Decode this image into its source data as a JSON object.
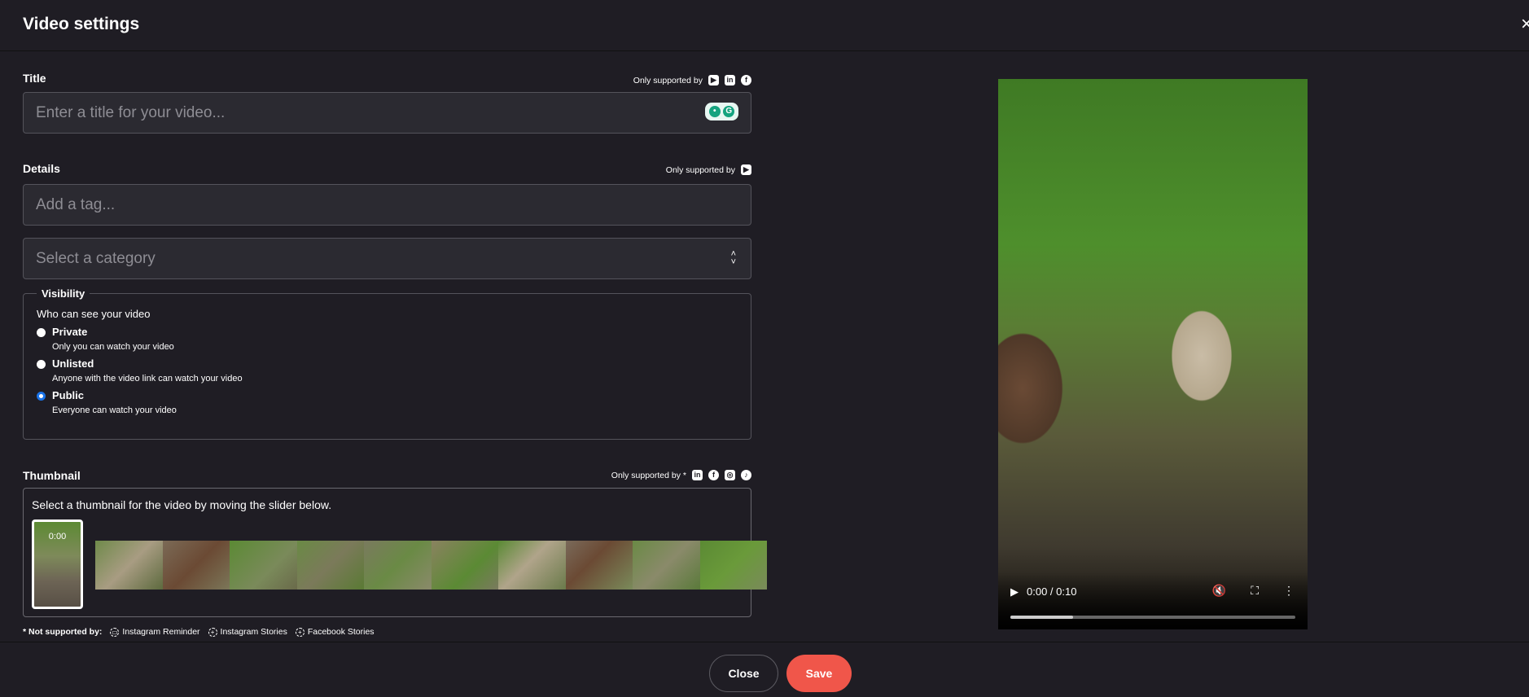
{
  "header": {
    "title": "Video settings",
    "close_icon": "×"
  },
  "title_section": {
    "label": "Title",
    "supported_label": "Only supported by",
    "platforms": [
      "youtube",
      "linkedin",
      "facebook"
    ],
    "placeholder": "Enter a title for your video..."
  },
  "details_section": {
    "label": "Details",
    "supported_label": "Only supported by",
    "platforms": [
      "youtube"
    ],
    "tag_placeholder": "Add a tag...",
    "category_placeholder": "Select a category"
  },
  "visibility": {
    "legend": "Visibility",
    "question": "Who can see your video",
    "options": [
      {
        "label": "Private",
        "desc": "Only you can watch your video",
        "selected": false
      },
      {
        "label": "Unlisted",
        "desc": "Anyone with the video link can watch your video",
        "selected": false
      },
      {
        "label": "Public",
        "desc": "Everyone can watch your video",
        "selected": true
      }
    ],
    "accent": "#1a73e8"
  },
  "thumbnail": {
    "label": "Thumbnail",
    "supported_label": "Only supported by *",
    "platforms": [
      "linkedin",
      "facebook",
      "instagram",
      "tiktok"
    ],
    "instruction": "Select a thumbnail for the video by moving the slider below.",
    "selected_time": "0:00"
  },
  "not_supported": {
    "label": "* Not supported by:",
    "items": [
      "Instagram Reminder",
      "Instagram Stories",
      "Facebook Stories"
    ]
  },
  "footer": {
    "close": "Close",
    "save": "Save",
    "save_color": "#f0564a"
  },
  "video": {
    "time": "0:00 / 0:10",
    "progress": 0.22
  }
}
